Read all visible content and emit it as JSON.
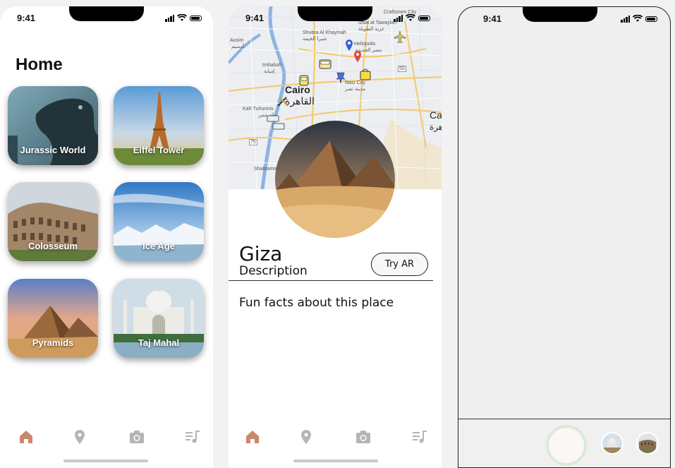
{
  "status_time": "9:41",
  "home": {
    "title": "Home",
    "cards": [
      {
        "label": "Jurassic World"
      },
      {
        "label": "Eiffel Tower"
      },
      {
        "label": "Colosseum"
      },
      {
        "label": "Ice Age"
      },
      {
        "label": "Pyramids"
      },
      {
        "label": "Taj Mahal"
      }
    ]
  },
  "tabbar": {
    "icons": [
      "home-icon",
      "location-pin-icon",
      "camera-icon",
      "playlist-icon"
    ],
    "active_color": "#c8896a",
    "inactive_color": "#b5b5b5"
  },
  "detail": {
    "map_labels": {
      "tawaylah": "Izbat at Tawaylah",
      "tawaylah_ar": "عزبة الطويلة",
      "craftsmen": "Craftsmen City",
      "shubra": "Shubra Al Khaymah",
      "shubra_ar": "شبرا الخيمة",
      "heliopolis": "Heliopolis",
      "heliopolis_ar": "مصر الجديدة",
      "ausim": "Ausim",
      "ausim_ar": "أوسيم",
      "imbabah": "Imbabah",
      "imbabah_ar": "إمبابة",
      "nasr": "Nasr City",
      "nasr_ar": "مدينة نصر",
      "cairo": "Cairo",
      "cairo_ar": "القاهرة",
      "kafr": "Kafr Tuhurmis",
      "kafr_ar": "طهرمس",
      "shabramant": "Shabramant",
      "ca": "Ca",
      "ca_ar": "هرة",
      "road_50": "50",
      "road_75": "75"
    },
    "name": "Giza",
    "description": "Description",
    "try_ar": "Try AR",
    "fun_facts": "Fun facts about this place"
  },
  "camera": {
    "thumbnails": [
      "taj-mahal-thumbnail",
      "colosseum-thumbnail"
    ]
  }
}
